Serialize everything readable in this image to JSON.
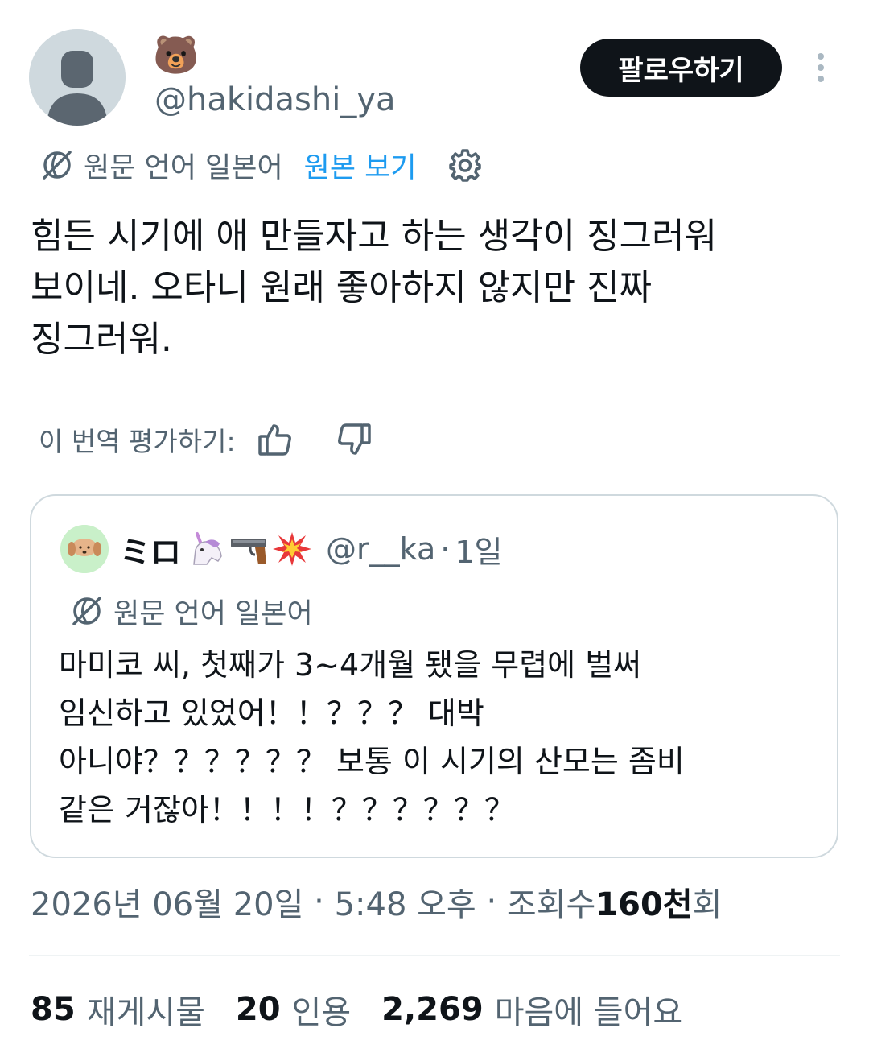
{
  "author": {
    "display_name": "🐻",
    "handle": "@hakidashi_ya"
  },
  "follow_button_label": "팔로우하기",
  "translation": {
    "source_label": "원문 언어 일본어",
    "show_original_label": "원본 보기"
  },
  "tweet_text": "힘든 시기에 애 만들자고 하는 생각이 징그러워\n보이네. 오타니 원래 좋아하지 않지만 진짜\n징그러워.",
  "rate_translation_label": "이 번역 평가하기:",
  "quoted": {
    "display_name": "ミロ",
    "emojis": [
      "unicorn-icon",
      "pistol-icon",
      "collision-icon"
    ],
    "handle": "@r__ka",
    "separator": "·",
    "time": "1일",
    "source_label": "원문 언어 일본어",
    "text": "마미코 씨, 첫째가 3~4개월 됐을 무렵에 벌써\n임신하고 있었어！！？？？ 대박\n아니야？？？？？？ 보통 이 시기의 산모는 좀비\n같은 거잖아！！！！？？？？？？"
  },
  "meta": {
    "date": "2026년 06월 20일",
    "time": "5:48 오후",
    "views_prefix": "조회수",
    "views_number": "160천",
    "views_suffix": "회",
    "separator": " · "
  },
  "stats": {
    "reposts_count": "85",
    "reposts_label": "재게시물",
    "quotes_count": "20",
    "quotes_label": "인용",
    "likes_count": "2,269",
    "likes_label": "마음에 들어요"
  },
  "colors": {
    "text": "#0f1419",
    "secondary": "#536471",
    "link": "#1d9bf0",
    "border": "#cfd9de"
  }
}
